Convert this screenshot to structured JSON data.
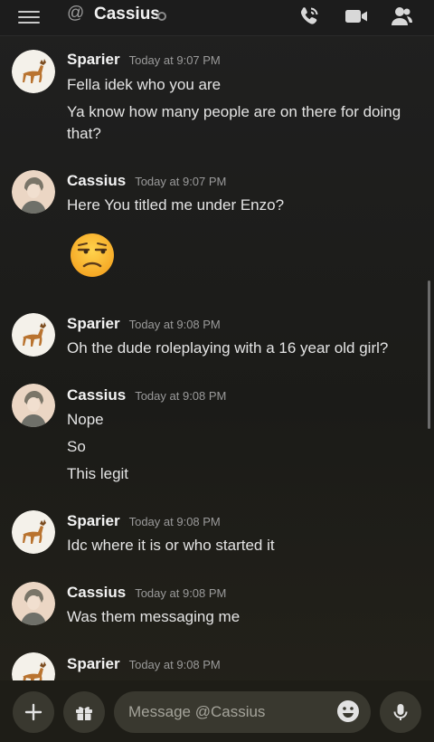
{
  "header": {
    "at_symbol": "@",
    "title": "Cassius",
    "icons": [
      "menu-icon",
      "at-icon",
      "voice-call-icon",
      "video-call-icon",
      "member-list-icon"
    ]
  },
  "messages": [
    {
      "author": "Sparier",
      "time": "Today at 9:07 PM",
      "lines": [
        "Fella idek who you are",
        "Ya know how many people are on there for doing",
        "that?"
      ]
    },
    {
      "author": "Cassius",
      "time": "Today at 9:07 PM",
      "lines": [
        "Here You titled me under Enzo?"
      ],
      "emoji": "unamused-face"
    },
    {
      "author": "Sparier",
      "time": "Today at 9:08 PM",
      "lines": [
        "Oh the dude roleplaying with a 16 year old girl?"
      ]
    },
    {
      "author": "Cassius",
      "time": "Today at 9:08 PM",
      "lines": [
        "Nope",
        "So",
        "This legit"
      ]
    },
    {
      "author": "Sparier",
      "time": "Today at 9:08 PM",
      "lines": [
        "Idc where it is or who started it"
      ]
    },
    {
      "author": "Cassius",
      "time": "Today at 9:08 PM",
      "lines": [
        "Was them messaging me"
      ]
    },
    {
      "author": "Sparier",
      "time": "Today at 9:08 PM",
      "lines": []
    }
  ],
  "composer": {
    "placeholder": "Message @Cassius",
    "value": ""
  },
  "colors": {
    "background": "#1f1f1c",
    "composer_bg": "#39382f",
    "text": "#e4e4e4",
    "timestamp": "#9a9a9a"
  }
}
